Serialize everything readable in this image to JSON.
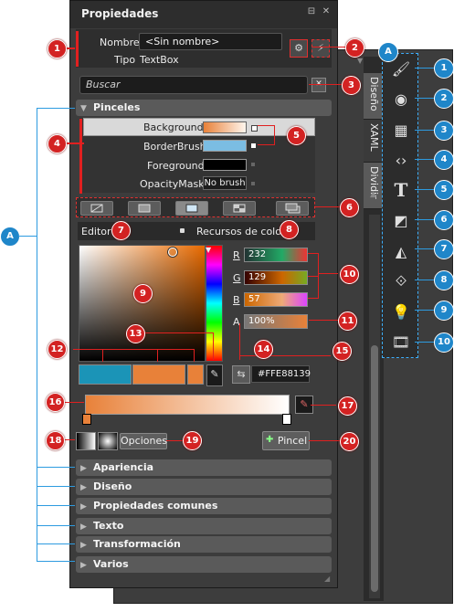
{
  "panel": {
    "title": "Propiedades",
    "name_label": "Nombre",
    "name_value": "<Sin nombre>",
    "type_label": "Tipo",
    "type_value": "TextBox",
    "search_placeholder": "Buscar"
  },
  "side_tabs": [
    "Diseño",
    "XAML",
    "Dividir"
  ],
  "brushes": {
    "section": "Pinceles",
    "rows": [
      {
        "label": "Background",
        "value": ""
      },
      {
        "label": "BorderBrush",
        "value": ""
      },
      {
        "label": "Foreground",
        "value": ""
      },
      {
        "label": "OpacityMask",
        "value": "No brush"
      }
    ],
    "editor_tab": "Editor",
    "resources_tab": "Recursos de color",
    "r_label": "R",
    "r_value": "232",
    "g_label": "G",
    "g_value": "129",
    "b_label": "B",
    "b_value": "57",
    "a_label": "A",
    "a_value": "100%",
    "hex_value": "#FFE88139",
    "options_button": "Opciones",
    "brush_button": "Pincel"
  },
  "sections": [
    "Apariencia",
    "Diseño",
    "Propiedades comunes",
    "Texto",
    "Transformación",
    "Varios"
  ],
  "badges": {
    "red": [
      "1",
      "2",
      "3",
      "4",
      "5",
      "6",
      "7",
      "8",
      "9",
      "10",
      "11",
      "12",
      "13",
      "14",
      "15",
      "16",
      "17",
      "18",
      "19",
      "20"
    ],
    "blue": [
      "A",
      "1",
      "2",
      "3",
      "4",
      "5",
      "6",
      "7",
      "8",
      "9",
      "10"
    ]
  },
  "toolbar_icons": [
    "brush-icon",
    "camera-icon",
    "grid-icon",
    "code-icon",
    "text-icon",
    "shapes-icon",
    "objects-icon",
    "link-icon",
    "bulb-icon",
    "media-icon"
  ],
  "colors": {
    "accent_red": "#d32222",
    "accent_blue": "#1f86c9",
    "selected_color": "#E88139"
  }
}
